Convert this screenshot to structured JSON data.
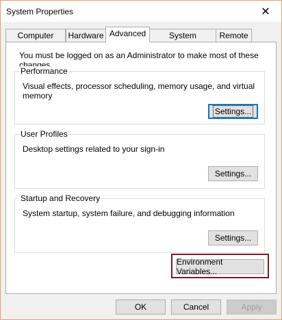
{
  "window": {
    "title": "System Properties"
  },
  "tabs": [
    {
      "label": "Computer Name"
    },
    {
      "label": "Hardware"
    },
    {
      "label": "Advanced"
    },
    {
      "label": "System Protection"
    },
    {
      "label": "Remote"
    }
  ],
  "admin_note": "You must be logged on as an Administrator to make most of these changes.",
  "performance": {
    "legend": "Performance",
    "description": "Visual effects, processor scheduling, memory usage, and virtual memory",
    "button": "Settings..."
  },
  "user_profiles": {
    "legend": "User Profiles",
    "description": "Desktop settings related to your sign-in",
    "button": "Settings..."
  },
  "startup_recovery": {
    "legend": "Startup and Recovery",
    "description": "System startup, system failure, and debugging information",
    "button": "Settings..."
  },
  "environment_button": "Environment Variables...",
  "footer": {
    "ok": "OK",
    "cancel": "Cancel",
    "apply": "Apply"
  },
  "icons": {
    "close": "✕"
  },
  "colors": {
    "focus_border": "#0078d7",
    "highlight_box": "#7a1a2a",
    "window_border": "#e0a060"
  }
}
